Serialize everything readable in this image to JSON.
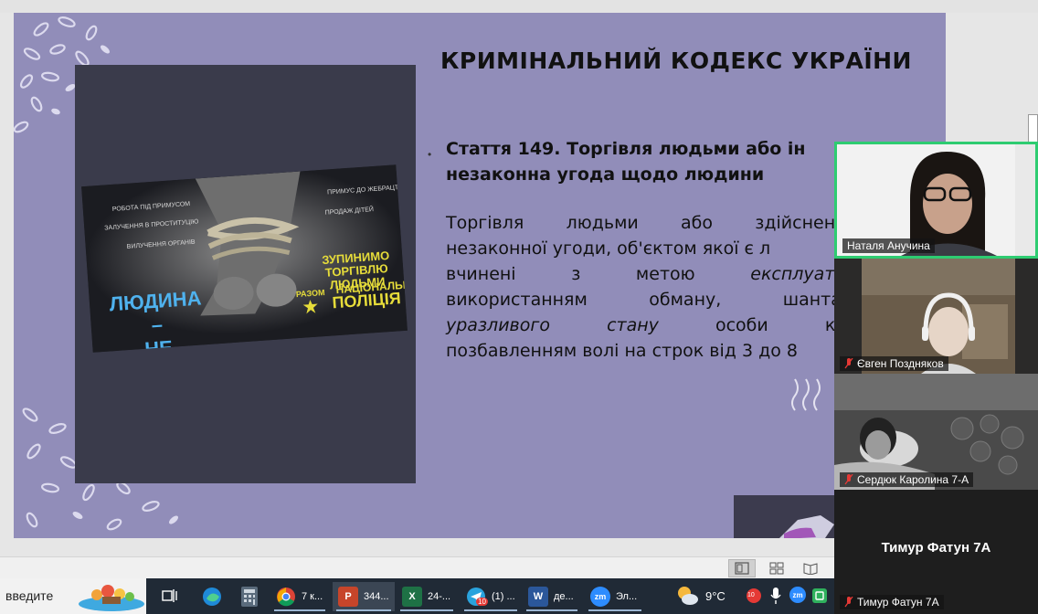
{
  "slide": {
    "title": "КРИМІНАЛЬНИЙ КОДЕКС УКРАЇНИ",
    "bullet": "•",
    "article_title_line1": "Стаття 149. Торгівля  людьми або ін",
    "article_title_line2": "незаконна угода щодо людини",
    "body": {
      "l1": [
        "Торгівля",
        "людьми",
        "або",
        "здійснення"
      ],
      "l2_a": "незаконної угоди, об'єктом якої є л",
      "l3": [
        "вчинені",
        "з",
        "метою",
        "експлуатац"
      ],
      "l4": [
        "використанням",
        "обману,",
        "шантаж"
      ],
      "l5": [
        "уразливого",
        "стану",
        "особи",
        "кар"
      ],
      "l6": "позбавленням волі на строк від 3 до 8"
    },
    "banner": {
      "left_items": [
        "РОБОТА ПІД ПРИМУСОМ",
        "ЗАЛУЧЕННЯ В ПРОСТИТУЦІЮ",
        "ВИЛУЧЕННЯ ОРГАНІВ"
      ],
      "right_items": [
        "ПРИМУС ДО ЖЕБРАЦТВА",
        "ПРОДАЖ ДІТЕЙ"
      ],
      "slogan_line1": "ЛЮДИНА –",
      "slogan_line2": "НЕ ТОВАР!",
      "stop_line1": "ЗУПИНИМО",
      "stop_line2": "ТОРГІВЛЮ ЛЮДЬМИ",
      "stop_line3": "РАЗОМ",
      "police_line1": "НАЦІОНАЛЬНА",
      "police_line2": "ПОЛІЦІЯ"
    }
  },
  "zoom": {
    "participants": [
      {
        "name": "Наталя Анучина",
        "muted": false
      },
      {
        "name": "Євген Поздняков",
        "muted": true
      },
      {
        "name": "Сердюк Каролина 7-А",
        "muted": true
      },
      {
        "name": "Тимур Фатун 7А",
        "muted": true,
        "video": false
      }
    ]
  },
  "taskbar": {
    "search_text": "введите",
    "items": [
      {
        "label": "7 к...",
        "icon": "chrome-icon"
      },
      {
        "label": "344...",
        "icon": "powerpoint-icon",
        "active": true
      },
      {
        "label": "24-...",
        "icon": "excel-icon"
      },
      {
        "label": "(1) ...",
        "icon": "telegram-icon",
        "badge": "10"
      },
      {
        "label": "де...",
        "icon": "word-icon"
      },
      {
        "label": "Эл...",
        "icon": "zoom-icon"
      }
    ],
    "weather": "9°C",
    "tray_badge": "10"
  },
  "colors": {
    "slide_bg": "#918db9",
    "photo_panel": "#3a3b4b",
    "zoom_active_border": "#2ecc71",
    "taskbar_bg": "#202a36"
  }
}
